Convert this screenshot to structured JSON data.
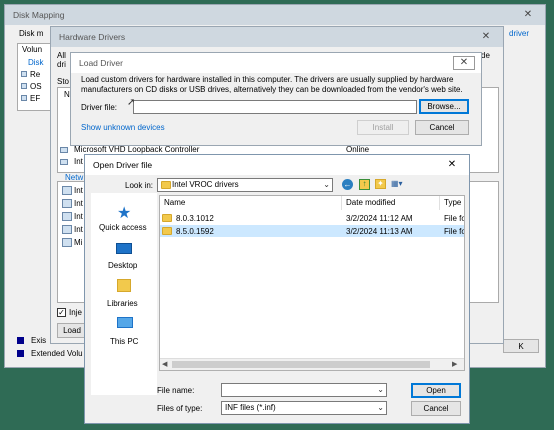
{
  "disk_mapping": {
    "title": "Disk Mapping",
    "close": "✕",
    "disk_label": "Disk m",
    "volume_label": "Volun",
    "tree": [
      "Disk",
      "Re",
      "OS",
      "EF"
    ],
    "right_link": "driver",
    "legend": [
      {
        "color": "#00008b",
        "label": "Exis"
      },
      {
        "color": "#00008b",
        "label": "Extended Volu"
      }
    ]
  },
  "hardware_drivers": {
    "title": "Hardware Drivers",
    "close": "✕",
    "all_label": "All",
    "dri_label": "dri",
    "sto_label": "Sto",
    "n_label": "N",
    "row_ms_vhd": "Microsoft VHD Loopback Controller",
    "row_ms_vhd_status": "Online",
    "row_int": "Int",
    "netw_label": "Netw",
    "net_items": [
      "Int",
      "Int",
      "Int",
      "Int",
      "Mi"
    ],
    "inject_label": "Inje",
    "load_button": "Load",
    "right_fragment": "de",
    "right_btn": "K"
  },
  "load_driver": {
    "title": "Load Driver",
    "close": "✕",
    "description": "Load custom drivers for hardware installed in this computer. The drivers are usually supplied by hardware manufacturers on CD disks or USB drives, alternatively they can be downloaded from the vendor's web site.",
    "driver_file_label": "Driver file:",
    "driver_file_value": "",
    "browse_button": "Browse...",
    "show_unknown_link": "Show unknown devices",
    "install_button": "Install",
    "cancel_button": "Cancel"
  },
  "open_driver": {
    "title": "Open Driver file",
    "close": "✕",
    "look_in_label": "Look in:",
    "look_in_value": "Intel VROC drivers",
    "places": [
      "Quick access",
      "Desktop",
      "Libraries",
      "This PC"
    ],
    "columns": [
      "Name",
      "Date modified",
      "Type"
    ],
    "files": [
      {
        "name": "8.0.3.1012",
        "date": "3/2/2024 11:12 AM",
        "type": "File fo"
      },
      {
        "name": "8.5.0.1592",
        "date": "3/2/2024 11:13 AM",
        "type": "File fo"
      }
    ],
    "file_name_label": "File name:",
    "file_name_value": "",
    "files_of_type_label": "Files of type:",
    "files_of_type_value": "INF files (*.inf)",
    "open_button": "Open",
    "cancel_button": "Cancel"
  }
}
